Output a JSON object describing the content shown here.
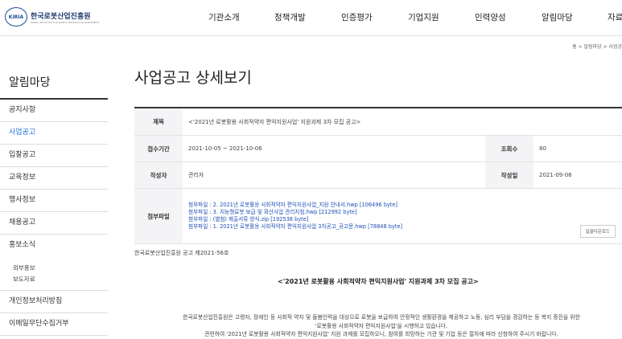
{
  "header": {
    "logo_mark": "KIRIA",
    "logo_text": "한국로봇산업진흥원",
    "logo_sub": "KOREA INSTITUTE FOR ROBOT INDUSTRY ADVANCEMENT",
    "nav": [
      "기관소개",
      "정책개발",
      "인증평가",
      "기업지원",
      "인력양성",
      "알림마당",
      "자료"
    ]
  },
  "breadcrumb": "홈 > 알림마당 > 사업공",
  "sidebar": {
    "title": "알림마당",
    "items": [
      "공지사항",
      "사업공고",
      "입찰공고",
      "교육정보",
      "행사정보",
      "채용공고",
      "홍보소식"
    ],
    "sub_items": [
      "외부홍보",
      "보도자료"
    ],
    "items2": [
      "개인정보처리방침",
      "이메일무단수집거부"
    ]
  },
  "page_title": "사업공고 상세보기",
  "detail": {
    "title_label": "제목",
    "title_value": "<'2021년 로봇활용 사회적약자 편익지원사업' 지원과제 3차 모집 공고>",
    "period_label": "접수기간",
    "period_value": "2021-10-05 ~ 2021-10-06",
    "views_label": "조회수",
    "views_value": "80",
    "author_label": "작성자",
    "author_value": "관리자",
    "date_label": "작성일",
    "date_value": "2021-09-06",
    "files_label": "첨부파일",
    "files": [
      "첨부파일 : 2. 2021년 로봇활용 사회적약자 편익지원사업_지원 안내서.hwp [106496 byte]",
      "첨부파일 : 3. 지능형로봇 보급 및 확산사업 관리지침.hwp [212992 byte]",
      "첨부파일 : (별첨) 제출서류 양식.zip [192538 byte]",
      "첨부파일 : 1. 2021년 로봇활용 사회적약자 편익지원사업 3차공고_공고문.hwp [78848 byte]"
    ],
    "download_all": "일괄다운로드"
  },
  "doc_number": "한국로봇산업진흥원 공고 제2021-56호",
  "headline": "<'2021년 로봇활용 사회적약자 편익지원사업' 지원과제 3차 모집 공고>",
  "body_lines": [
    "한국로봇산업진흥원은 고령자, 장애인 등 사회적 약자 및 돌봄인력을 대상으로 로봇을 보급하여 안정적인 생활환경을 제공하고 노동, 심리 부담을 경감하는 등 복지 증진을 위한",
    "'로봇활용 사회적약자 편익지원사업'을 시행하고 있습니다.",
    "관련하여 '2021년 로봇활용 사회적약자 편익지원사업' 지원 과제를 모집하오니, 참여를 희망하는 기관 및 기업 등은 절차에 따라 신청하여 주시기 바랍니다."
  ]
}
